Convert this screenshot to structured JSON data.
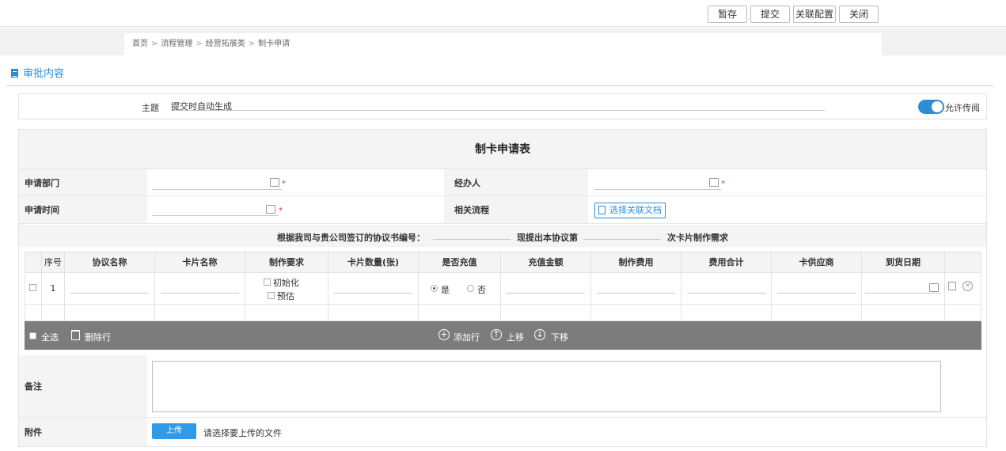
{
  "toolbar": {
    "save_draft": "暂存",
    "submit": "提交",
    "link_config": "关联配置",
    "close": "关闭"
  },
  "breadcrumb": {
    "items": [
      "首页",
      "流程管理",
      "经营拓展类",
      "制卡申请"
    ],
    "separator": ">"
  },
  "section": {
    "title": "审批内容"
  },
  "subject": {
    "label": "主题",
    "value": "提交时自动生成",
    "toggle_label": "允许传阅"
  },
  "form": {
    "title": "制卡申请表",
    "dept_label": "申请部门",
    "handler_label": "经办人",
    "time_label": "申请时间",
    "process_label": "相关流程",
    "select_doc_button": "选择关联文档",
    "required_mark": "*",
    "agreement": {
      "part1": "根据我司与贵公司签订的协议书编号：",
      "part2": "现提出本协议第",
      "part3": "次卡片制作需求"
    }
  },
  "detail_table": {
    "headers": [
      "序号",
      "协议名称",
      "卡片名称",
      "制作要求",
      "卡片数量(张)",
      "是否充值",
      "充值金额",
      "制作费用",
      "费用合计",
      "卡供应商",
      "到货日期"
    ],
    "row1": {
      "index": "1",
      "req_opt1": "初始化",
      "req_opt2": "预估",
      "radio_yes": "是",
      "radio_no": "否"
    }
  },
  "actions": {
    "select_all": "全选",
    "delete_row": "删除行",
    "add_row": "添加行",
    "move_up": "上移",
    "move_down": "下移"
  },
  "note": {
    "label": "备注"
  },
  "attachment": {
    "label": "附件",
    "upload_button": "上传",
    "hint": "请选择要上传的文件"
  }
}
